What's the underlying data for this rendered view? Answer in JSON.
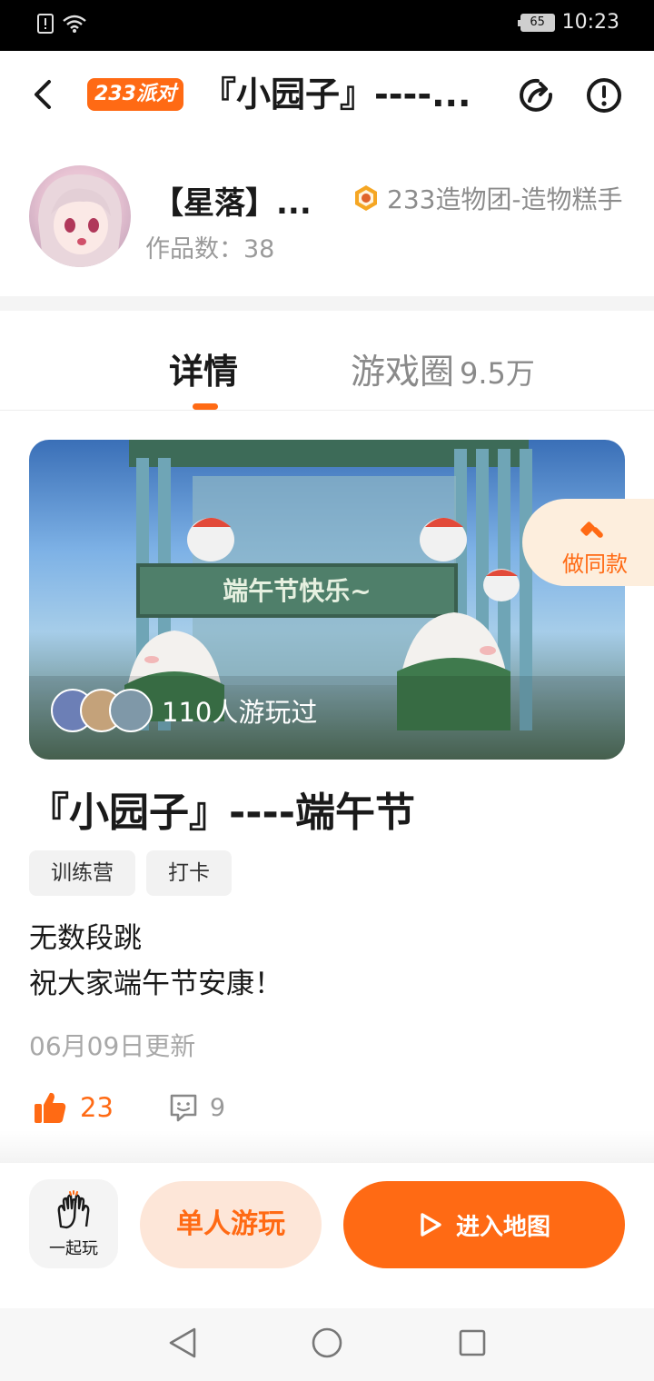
{
  "status_bar": {
    "time": "10:23",
    "battery": "65",
    "icons": [
      "alert-icon",
      "wifi-icon"
    ]
  },
  "header": {
    "back_icon": "chevron-left-icon",
    "badge": "233派对",
    "title": "『小园子』----...",
    "share_icon": "share-icon",
    "report_icon": "report-icon"
  },
  "author": {
    "name": "【星落】...",
    "works_label": "作品数：38",
    "organization": "233造物团-造物糕手"
  },
  "tabs": [
    {
      "label": "详情"
    },
    {
      "label": "游戏圈",
      "count": "9.5万"
    }
  ],
  "banner": {
    "played_text": "110人游玩过"
  },
  "make_same": {
    "label": "做同款"
  },
  "game": {
    "title": "『小园子』----端午节",
    "tags": [
      "训练营",
      "打卡"
    ],
    "description_lines": [
      "无数段跳",
      "祝大家端午节安康！"
    ],
    "updated": "06月09日更新"
  },
  "stats": {
    "likes": "23",
    "comments": "9"
  },
  "actions": {
    "play_together": "一起玩",
    "single_play": "单人游玩",
    "enter_map": "进入地图"
  },
  "colors": {
    "accent": "#ff6a14",
    "accent_light": "#fde6d8"
  }
}
